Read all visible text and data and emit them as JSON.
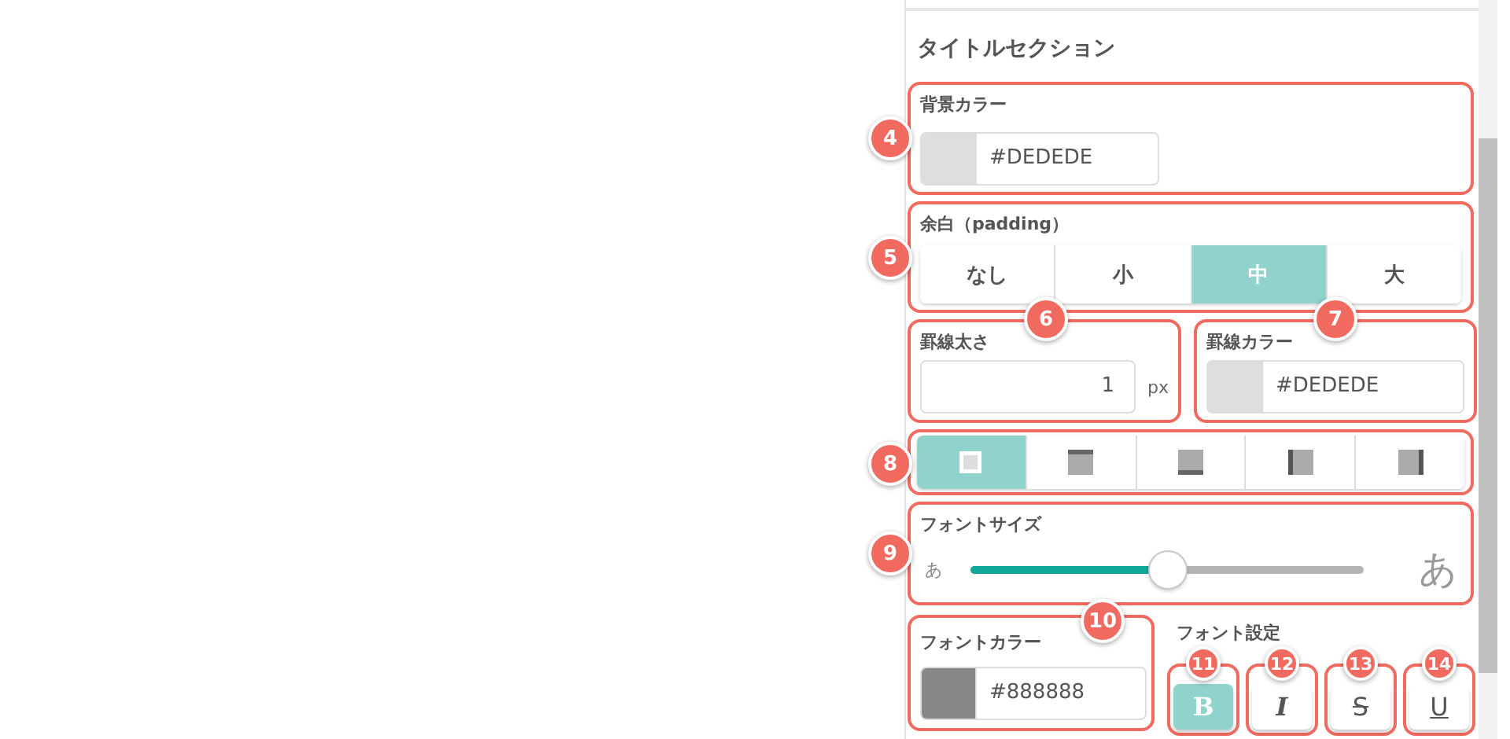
{
  "section_title": "タイトルセクション",
  "background_color": {
    "badge": "4",
    "label": "背景カラー",
    "color": "#dedede",
    "value": "#DEDEDE"
  },
  "padding": {
    "badge": "5",
    "label": "余白（padding）",
    "options": [
      {
        "label": "なし",
        "selected": false
      },
      {
        "label": "小",
        "selected": false
      },
      {
        "label": "中",
        "selected": true
      },
      {
        "label": "大",
        "selected": false
      }
    ]
  },
  "border_width": {
    "badge": "6",
    "label": "罫線太さ",
    "value": "1",
    "unit": "px"
  },
  "border_color": {
    "badge": "7",
    "label": "罫線カラー",
    "color": "#dedede",
    "value": "#DEDEDE"
  },
  "border_sides": {
    "badge": "8",
    "options": [
      {
        "kind": "all",
        "selected": true
      },
      {
        "kind": "top",
        "selected": false
      },
      {
        "kind": "bottom",
        "selected": false
      },
      {
        "kind": "left",
        "selected": false
      },
      {
        "kind": "right",
        "selected": false
      }
    ]
  },
  "font_size": {
    "badge": "9",
    "label": "フォントサイズ",
    "small_glyph": "あ",
    "large_glyph": "あ",
    "level": 0.5
  },
  "font_color": {
    "badge": "10",
    "label": "フォントカラー",
    "color": "#888888",
    "value": "#888888"
  },
  "font_style": {
    "label": "フォント設定",
    "buttons": [
      {
        "kind": "bold",
        "text": "B",
        "badge": "11",
        "selected": true
      },
      {
        "kind": "italic",
        "text": "I",
        "badge": "12",
        "selected": false
      },
      {
        "kind": "strike",
        "text": "S",
        "badge": "13",
        "selected": false
      },
      {
        "kind": "underline",
        "text": "U",
        "badge": "14",
        "selected": false
      }
    ]
  }
}
